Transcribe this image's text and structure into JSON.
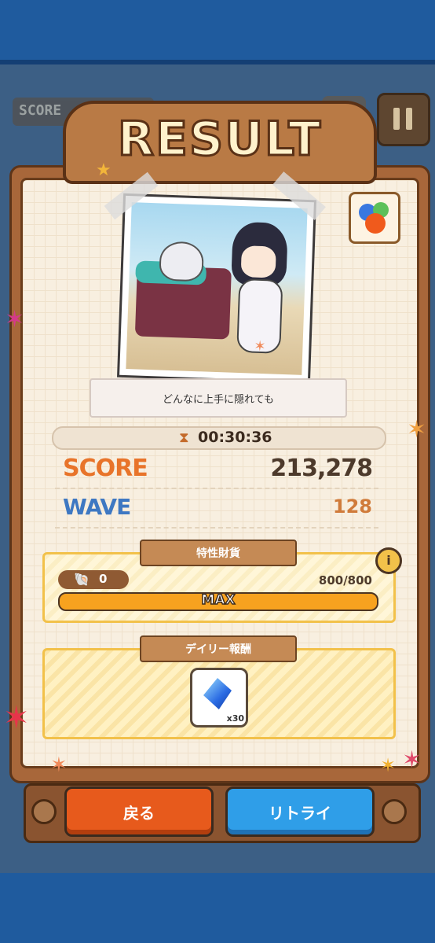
{
  "hud": {
    "score_label": "SCORE"
  },
  "title": "RESULT",
  "caption": "どんなに上手に隠れても",
  "timer": "00:30:36",
  "stats": {
    "score_label": "SCORE",
    "score_value": "213,278",
    "wave_label": "WAVE",
    "wave_value": "128"
  },
  "trait_currency": {
    "title": "特性財貨",
    "count": "0",
    "progress_text": "800/800",
    "progress": 1.0,
    "bar_label": "MAX",
    "info_icon": "info-icon"
  },
  "daily_reward": {
    "title": "デイリー報酬",
    "item_icon": "blue-crystal-icon",
    "quantity": "x30"
  },
  "buttons": {
    "back": "戻る",
    "retry": "リトライ"
  },
  "colors": {
    "score_orange": "#e8742a",
    "wave_blue": "#3e78c2",
    "back_button": "#e75a1c",
    "retry_button": "#2f9ee8",
    "panel_yellow": "#f2c14a"
  }
}
